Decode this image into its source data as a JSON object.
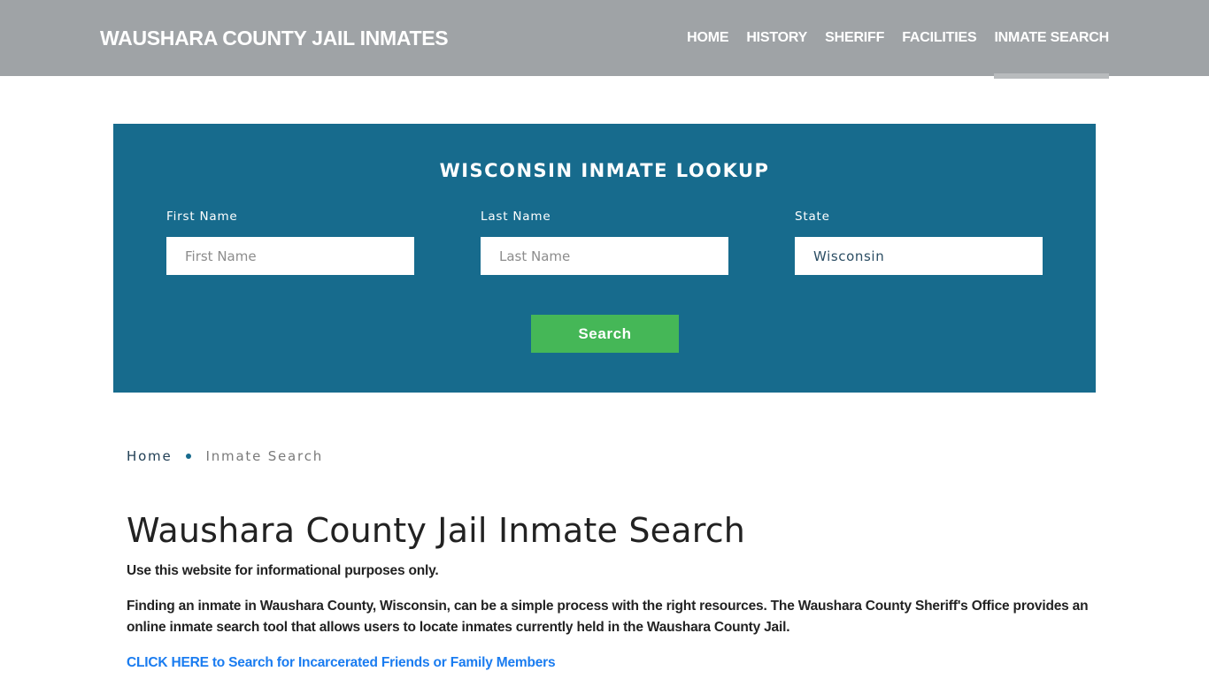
{
  "header": {
    "brand": "WAUSHARA COUNTY JAIL INMATES",
    "nav": [
      {
        "label": "HOME",
        "active": false
      },
      {
        "label": "HISTORY",
        "active": false
      },
      {
        "label": "SHERIFF",
        "active": false
      },
      {
        "label": "FACILITIES",
        "active": false
      },
      {
        "label": "INMATE SEARCH",
        "active": true
      }
    ]
  },
  "lookup": {
    "title": "WISCONSIN INMATE LOOKUP",
    "fields": {
      "first_name": {
        "label": "First Name",
        "placeholder": "First Name",
        "value": ""
      },
      "last_name": {
        "label": "Last Name",
        "placeholder": "Last Name",
        "value": ""
      },
      "state": {
        "label": "State",
        "value": "Wisconsin"
      }
    },
    "search_button": "Search",
    "colors": {
      "panel_bg": "#176b8d",
      "button_bg": "#45b757"
    }
  },
  "breadcrumb": {
    "home": "Home",
    "current": "Inmate Search"
  },
  "content": {
    "title": "Waushara County Jail Inmate Search",
    "disclaimer": "Use this website for informational purposes only.",
    "intro": "Finding an inmate in Waushara County, Wisconsin, can be a simple process with the right resources. The Waushara County Sheriff's Office provides an online inmate search tool that allows users to locate inmates currently held in the Waushara County Jail.",
    "cta_link": "CLICK HERE to Search for Incarcerated Friends or Family Members"
  }
}
